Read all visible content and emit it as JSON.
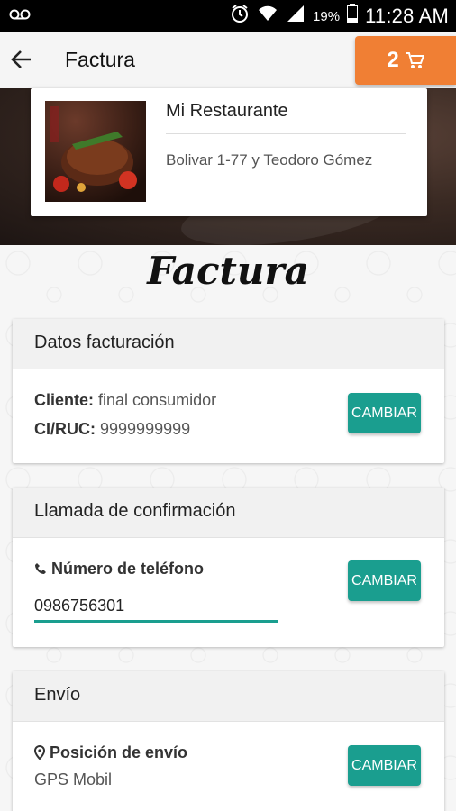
{
  "status_bar": {
    "battery_percent": "19%",
    "time": "11:28 AM",
    "icons": [
      "voicemail-icon",
      "alarm-icon",
      "wifi-icon",
      "signal-icon",
      "battery-icon"
    ]
  },
  "app_bar": {
    "title": "Factura",
    "back_icon": "arrow-left-icon",
    "cart": {
      "count": "2",
      "icon": "cart-icon",
      "color": "#f07f34"
    }
  },
  "restaurant": {
    "name": "Mi Restaurante",
    "address": "Bolivar 1-77 y Teodoro Gómez"
  },
  "page_heading": "Factura",
  "billing": {
    "header": "Datos facturación",
    "client_label": "Cliente:",
    "client_value": "final   consumidor",
    "id_label": "CI/RUC:",
    "id_value": "9999999999",
    "button": "CAMBIAR"
  },
  "confirmation": {
    "header": "Llamada de confirmación",
    "phone_label": "Número de teléfono",
    "phone_value": "0986756301",
    "button": "CAMBIAR"
  },
  "shipping": {
    "header": "Envío",
    "position_label": "Posición de envío",
    "position_value": "GPS Mobil",
    "button": "CAMBIAR"
  },
  "colors": {
    "accent": "#1a9e8f",
    "cart": "#f07f34"
  }
}
